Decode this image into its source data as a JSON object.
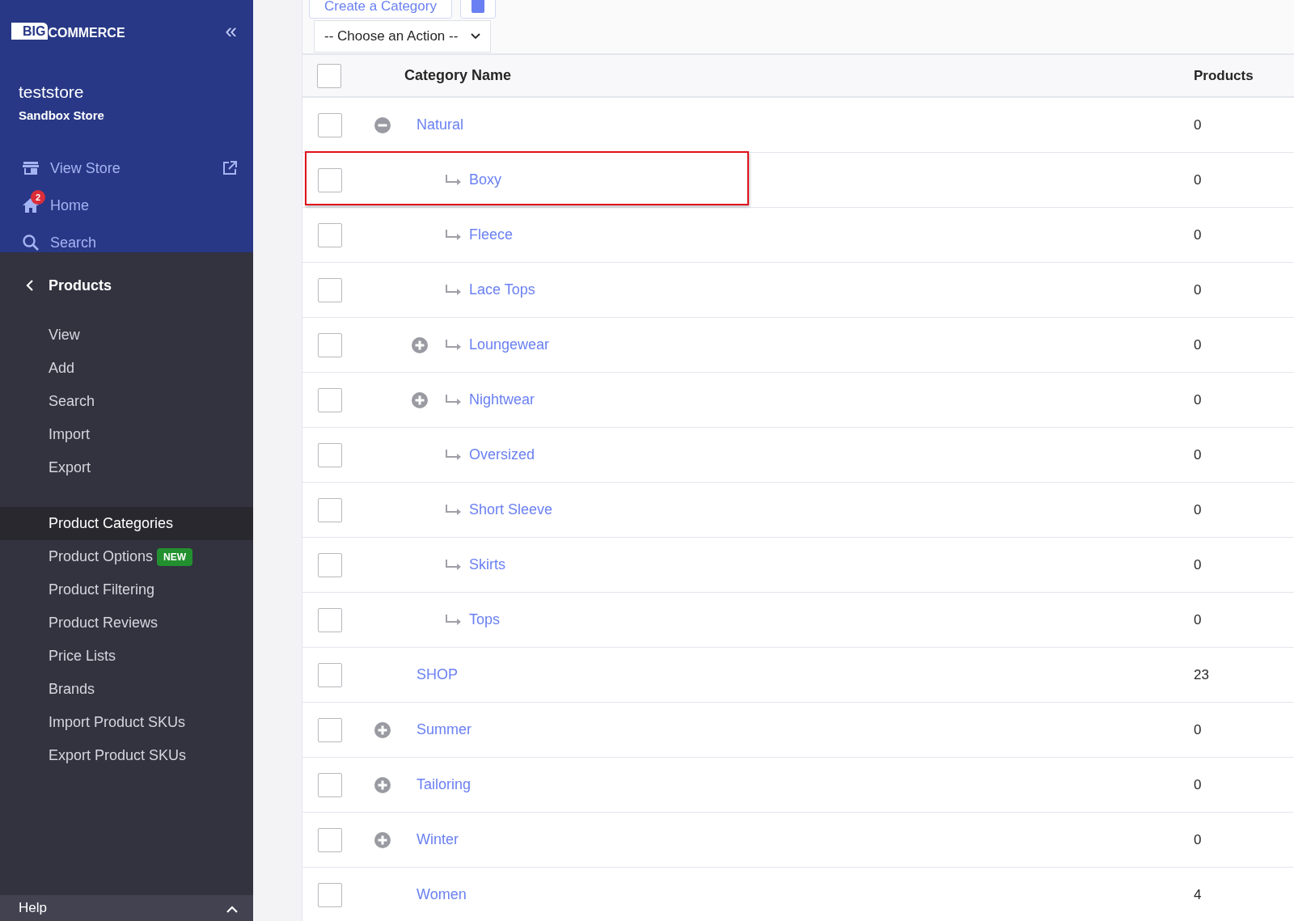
{
  "sidebar": {
    "logo": {
      "mark": "BIG",
      "word": "COMMERCE"
    },
    "collapse_icon": "«",
    "store": {
      "name": "teststore",
      "type": "Sandbox Store"
    },
    "top_links": [
      {
        "label": "View Store",
        "kind": "store",
        "external": true
      },
      {
        "label": "Home",
        "kind": "home",
        "badge": "2"
      },
      {
        "label": "Search",
        "kind": "search"
      }
    ],
    "section": {
      "title": "Products"
    },
    "items": [
      {
        "label": "View",
        "selected": false
      },
      {
        "label": "Add",
        "selected": false
      },
      {
        "label": "Search",
        "selected": false
      },
      {
        "label": "Import",
        "selected": false
      },
      {
        "label": "Export",
        "selected": false,
        "group_end": true
      },
      {
        "label": "Product Categories",
        "selected": true
      },
      {
        "label": "Product Options",
        "selected": false,
        "badge": "NEW"
      },
      {
        "label": "Product Filtering",
        "selected": false
      },
      {
        "label": "Product Reviews",
        "selected": false
      },
      {
        "label": "Price Lists",
        "selected": false
      },
      {
        "label": "Brands",
        "selected": false
      },
      {
        "label": "Import Product SKUs",
        "selected": false
      },
      {
        "label": "Export Product SKUs",
        "selected": false
      }
    ],
    "footer": {
      "label": "Help",
      "expanded": true
    }
  },
  "toolbar": {
    "create_button": "Create a Category",
    "action_select": "-- Choose an Action --"
  },
  "table": {
    "columns": [
      "Category Name",
      "Products"
    ],
    "header_checked": false,
    "rows": [
      {
        "name": "Natural",
        "products": "0",
        "checked": false,
        "highlighted": false,
        "expanded": true,
        "children": [
          {
            "name": "Boxy",
            "products": "0",
            "checked": false,
            "highlighted": true
          },
          {
            "name": "Fleece",
            "products": "0",
            "checked": false,
            "highlighted": false
          },
          {
            "name": "Lace Tops",
            "products": "0",
            "checked": false,
            "highlighted": false
          },
          {
            "name": "Loungewear",
            "products": "0",
            "checked": false,
            "highlighted": false,
            "expanded": false
          },
          {
            "name": "Nightwear",
            "products": "0",
            "checked": false,
            "highlighted": false,
            "expanded": false
          },
          {
            "name": "Oversized",
            "products": "0",
            "checked": false,
            "highlighted": false
          },
          {
            "name": "Short Sleeve",
            "products": "0",
            "checked": false,
            "highlighted": false
          },
          {
            "name": "Skirts",
            "products": "0",
            "checked": false,
            "highlighted": false
          },
          {
            "name": "Tops",
            "products": "0",
            "checked": false,
            "highlighted": false
          }
        ]
      },
      {
        "name": "SHOP",
        "products": "23",
        "checked": false,
        "highlighted": false
      },
      {
        "name": "Summer",
        "products": "0",
        "checked": false,
        "highlighted": false,
        "expanded": false
      },
      {
        "name": "Tailoring",
        "products": "0",
        "checked": false,
        "highlighted": false,
        "expanded": false
      },
      {
        "name": "Winter",
        "products": "0",
        "checked": false,
        "highlighted": false,
        "expanded": false
      },
      {
        "name": "Women",
        "products": "4",
        "checked": false,
        "highlighted": false
      }
    ]
  }
}
